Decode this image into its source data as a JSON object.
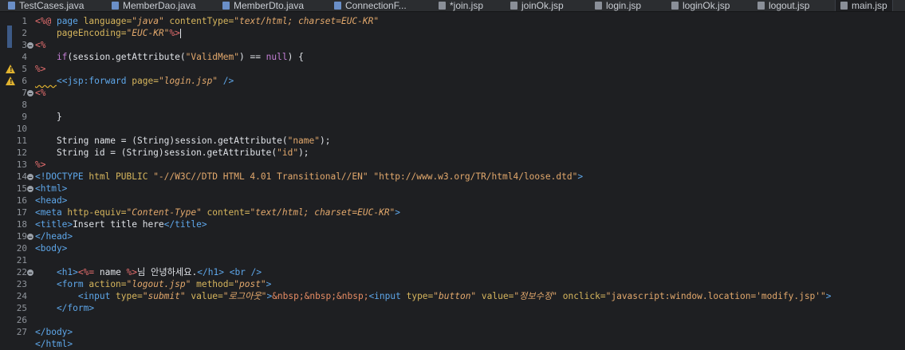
{
  "tabs": [
    {
      "label": "TestCases.java",
      "type": "java"
    },
    {
      "label": "MemberDao.java",
      "type": "java"
    },
    {
      "label": "MemberDto.java",
      "type": "java"
    },
    {
      "label": "ConnectionF...",
      "type": "java"
    },
    {
      "label": "*join.jsp",
      "type": "jsp"
    },
    {
      "label": "joinOk.jsp",
      "type": "jsp"
    },
    {
      "label": "login.jsp",
      "type": "jsp"
    },
    {
      "label": "loginOk.jsp",
      "type": "jsp"
    },
    {
      "label": "logout.jsp",
      "type": "jsp"
    },
    {
      "label": "main.jsp",
      "type": "jsp",
      "active": true
    }
  ],
  "line_numbers": [
    "1",
    "2",
    "3",
    "4",
    "5",
    "6",
    "7",
    "8",
    "9",
    "10",
    "11",
    "12",
    "13",
    "14",
    "15",
    "16",
    "17",
    "18",
    "19",
    "20",
    "21",
    "22",
    "23",
    "24",
    "25",
    "26",
    "27"
  ],
  "code": {
    "l1_a": "<%@ ",
    "l1_b": "page ",
    "l1_c": "language=",
    "l1_d": "\"java\"",
    "l1_e": " contentType=",
    "l1_f": "\"text/html; charset=EUC-KR\"",
    "l2_a": "    pageEncoding=",
    "l2_b": "\"EUC-KR\"",
    "l2_c": "%",
    "l3": "<%",
    "l4_a": "    ",
    "l4_b": "if",
    "l4_c": "(session.getAttribute(",
    "l4_d": "\"ValidMem\"",
    "l4_e": ") == ",
    "l4_f": "null",
    "l4_g": ") {",
    "l5": "%>",
    "l6_a": "    ",
    "l6_b": "<",
    "l6_c": "<jsp:forward ",
    "l6_d": "page=",
    "l6_e": "\"login.jsp\"",
    "l6_f": " />",
    "l7": "<%",
    "l9": "    }",
    "l10_a": "    String name = (String)session.getAttribute(",
    "l10_b": "\"name\"",
    "l10_c": ");",
    "l11_a": "    String id = (String)session.getAttribute(",
    "l11_b": "\"id\"",
    "l11_c": ");",
    "l12": "%>",
    "l13_a": "<!DOCTYPE ",
    "l13_b": "html PUBLIC ",
    "l13_c": "\"-//W3C//DTD HTML 4.01 Transitional//EN\"",
    "l13_d": " ",
    "l13_e": "\"http://www.w3.org/TR/html4/loose.dtd\"",
    "l13_f": ">",
    "l14": "<html>",
    "l15": "<head>",
    "l16_a": "<meta ",
    "l16_b": "http-equiv=",
    "l16_c": "\"Content-Type\"",
    "l16_d": " content=",
    "l16_e": "\"text/html; charset=EUC-KR\"",
    "l16_f": ">",
    "l17_a": "<title>",
    "l17_b": "Insert title here",
    "l17_c": "</title>",
    "l18": "</head>",
    "l19": "<body>",
    "l21_a": "    ",
    "l21_b": "<h1>",
    "l21_c": "<%=",
    "l21_d": " name ",
    "l21_e": "%>",
    "l21_f": "님 안녕하세요.",
    "l21_g": "</h1>",
    "l21_h": " ",
    "l21_i": "<br />",
    "l22_a": "    ",
    "l22_b": "<form ",
    "l22_c": "action=",
    "l22_d": "\"logout.jsp\"",
    "l22_e": " method=",
    "l22_f": "\"post\"",
    "l22_g": ">",
    "l23_a": "        ",
    "l23_b": "<input ",
    "l23_c": "type=",
    "l23_d": "\"submit\"",
    "l23_e": " value=",
    "l23_f": "\"로그아웃\"",
    "l23_g": ">",
    "l23_h": "&nbsp;&nbsp;&nbsp;",
    "l23_i": "<input ",
    "l23_j": "type=",
    "l23_k": "\"button\"",
    "l23_l": " value=",
    "l23_m": "\"정보수정\"",
    "l23_n": " onclick=",
    "l23_o": "\"javascript:window.location='modify.jsp'\"",
    "l23_p": ">",
    "l24": "    </form>",
    "l26": "</body>",
    "l27": "</html>"
  },
  "colors": {
    "background": "#1e1f22",
    "tag": "#5ea7ea",
    "attribute": "#d7b65d",
    "string": "#e2a86c",
    "keyword": "#c47fd5",
    "warning": "#e0b22f"
  }
}
